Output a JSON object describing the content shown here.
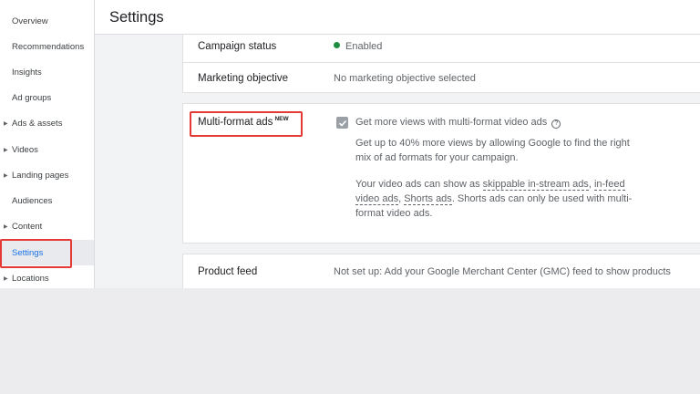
{
  "sidebar": {
    "items": [
      {
        "label": "Overview"
      },
      {
        "label": "Recommendations"
      },
      {
        "label": "Insights"
      },
      {
        "label": "Ad groups"
      },
      {
        "label": "Ads & assets"
      },
      {
        "label": "Videos"
      },
      {
        "label": "Landing pages"
      },
      {
        "label": "Audiences"
      },
      {
        "label": "Content"
      },
      {
        "label": "Settings"
      },
      {
        "label": "Locations"
      }
    ],
    "active": "Settings"
  },
  "header": {
    "title": "Settings"
  },
  "campaign_status": {
    "label": "Campaign status",
    "value": "Enabled",
    "status_color": "#1e8e3e"
  },
  "marketing_objective": {
    "label": "Marketing objective",
    "value": "No marketing objective selected"
  },
  "multi_format": {
    "label": "Multi-format ads",
    "badge": "NEW",
    "checkbox_label": "Get more views with multi-format video ads",
    "help_icon": "?",
    "desc_line1": "Get up to 40% more views by allowing Google to find the right",
    "desc_line2": "mix of ad formats for your campaign.",
    "p2_prefix": "Your video ads can show as ",
    "link1": "skippable in-stream ads",
    "sep1": ", ",
    "link2a": "in-feed",
    "link2b": "video ads",
    "sep2": ", ",
    "link3": "Shorts ads",
    "p2_suffix_a": ". Shorts ads can only be used with multi-",
    "p2_suffix_b": "format video ads."
  },
  "product_feed": {
    "label": "Product feed",
    "value": "Not set up: Add your Google Merchant Center (GMC) feed to show products"
  },
  "colors": {
    "highlight": "#e53935",
    "accent": "#1a73e8"
  }
}
